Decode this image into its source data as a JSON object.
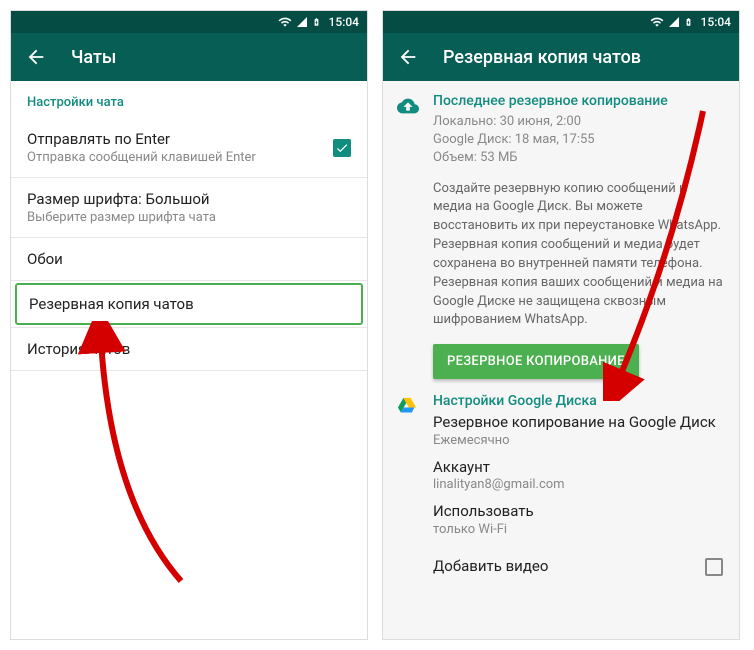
{
  "statusbar": {
    "time": "15:04"
  },
  "screen1": {
    "title": "Чаты",
    "section": "Настройки чата",
    "enter": {
      "title": "Отправлять по Enter",
      "subtitle": "Отправка сообщений клавишей Enter"
    },
    "fontsize": {
      "title": "Размер шрифта: Большой",
      "subtitle": "Выберите размер шрифта чата"
    },
    "wallpaper": "Обои",
    "backup": "Резервная копия чатов",
    "history": "История чатов"
  },
  "screen2": {
    "title": "Резервная копия чатов",
    "last_backup": {
      "header": "Последнее резервное копирование",
      "local": "Локально: 30 июня, 2:00",
      "gdrive": "Google Диск: 18 мая, 17:55",
      "size": "Объем: 53 МБ"
    },
    "description": "Создайте резервную копию сообщений и медиа на Google Диск. Вы можете восстановить их при переустановке WhatsApp. Резервная копия сообщений и медиа будет сохранена во внутренней памяти телефона. Резервная копия ваших сообщений и медиа на Google Диске не защищена сквозным шифрованием WhatsApp.",
    "backup_button": "РЕЗЕРВНОЕ КОПИРОВАНИЕ",
    "gdrive": {
      "header": "Настройки Google Диска",
      "freq_title": "Резервное копирование на Google Диск",
      "freq_value": "Ежемесячно",
      "account_title": "Аккаунт",
      "account_value": "linalityan8@gmail.com",
      "network_title": "Использовать",
      "network_value": "только Wi-Fi",
      "video": "Добавить видео"
    }
  }
}
